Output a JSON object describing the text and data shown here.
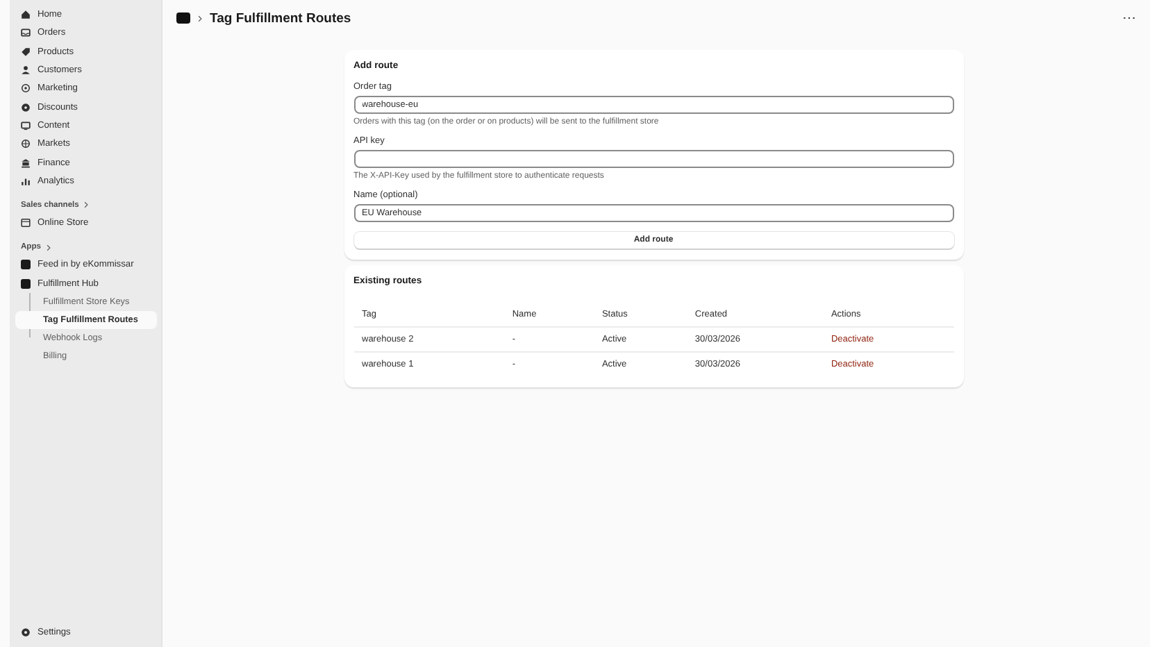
{
  "sidebar": {
    "nav": [
      {
        "label": "Home"
      },
      {
        "label": "Orders"
      },
      {
        "label": "Products"
      },
      {
        "label": "Customers"
      },
      {
        "label": "Marketing"
      },
      {
        "label": "Discounts"
      },
      {
        "label": "Content"
      },
      {
        "label": "Markets"
      },
      {
        "label": "Finance"
      },
      {
        "label": "Analytics"
      }
    ],
    "sales_channels": {
      "heading": "Sales channels",
      "items": [
        {
          "label": "Online Store"
        }
      ]
    },
    "apps": {
      "heading": "Apps",
      "items": [
        {
          "label": "Feed in by eKommissar"
        },
        {
          "label": "Fulfillment Hub",
          "children": [
            {
              "label": "Fulfillment Store Keys",
              "selected": false
            },
            {
              "label": "Tag Fulfillment Routes",
              "selected": true
            },
            {
              "label": "Webhook Logs",
              "selected": false
            },
            {
              "label": "Billing",
              "selected": false
            }
          ]
        }
      ]
    },
    "settings": "Settings"
  },
  "header": {
    "title": "Tag Fulfillment Routes",
    "more": "⋯"
  },
  "add_route": {
    "title": "Add route",
    "fields": [
      {
        "label": "Order tag",
        "value": "warehouse-eu",
        "help": "Orders with this tag (on the order or on products) will be sent to the fulfillment store"
      },
      {
        "label": "API key",
        "help": "The X-API-Key used by the fulfillment store to authenticate requests"
      },
      {
        "label": "Name (optional)",
        "value": "EU Warehouse"
      }
    ],
    "button": "Add route"
  },
  "existing_routes": {
    "title": "Existing routes",
    "table": {
      "columns": [
        "Tag",
        "Name",
        "Status",
        "Created",
        "Actions"
      ],
      "rows": [
        [
          "warehouse 2",
          "-",
          "Active",
          "30/03/2026",
          "Deactivate"
        ],
        [
          "warehouse 1",
          "-",
          "Active",
          "30/03/2026",
          "Deactivate"
        ]
      ]
    }
  }
}
